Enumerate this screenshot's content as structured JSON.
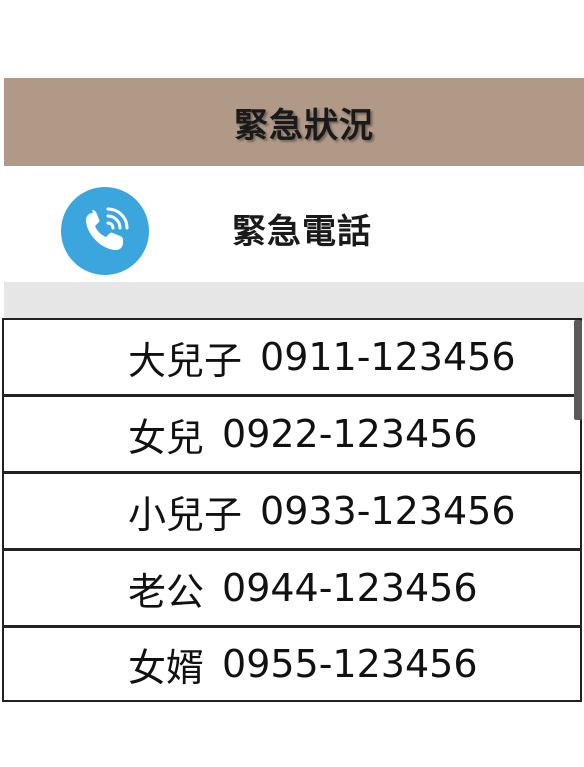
{
  "header": {
    "title": "緊急狀況",
    "bg_color": "#b09a87"
  },
  "section": {
    "icon": "phone-icon",
    "icon_color": "#3aa6dd",
    "title": "緊急電話"
  },
  "contacts": [
    {
      "name": "大兒子",
      "phone": "0911-123456"
    },
    {
      "name": "女兒",
      "phone": "0922-123456"
    },
    {
      "name": "小兒子",
      "phone": "0933-123456"
    },
    {
      "name": "老公",
      "phone": "0944-123456"
    },
    {
      "name": "女婿",
      "phone": "0955-123456"
    }
  ]
}
